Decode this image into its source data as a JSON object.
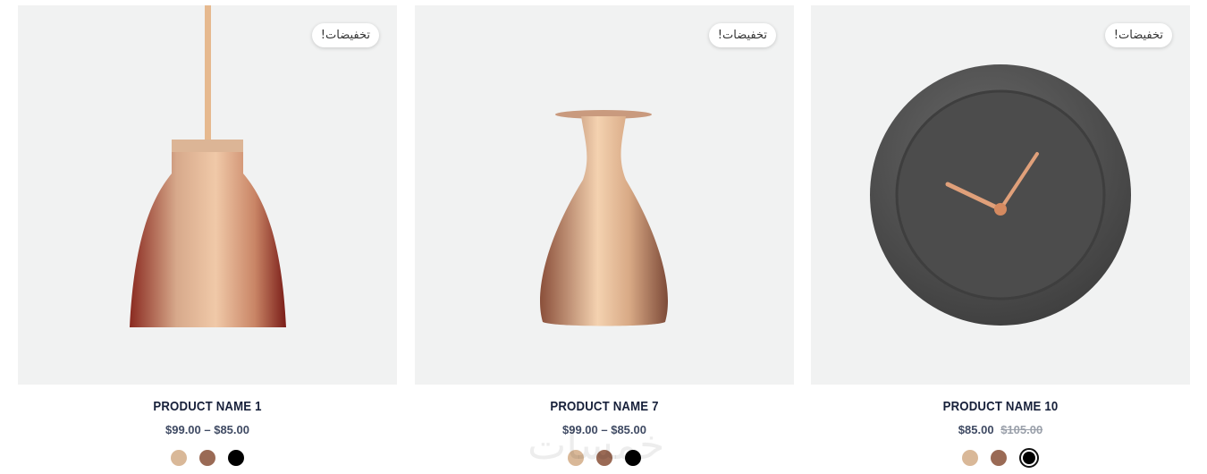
{
  "products": [
    {
      "badge": "تخفيضات!",
      "name": "PRODUCT NAME 1",
      "price": "$99.00 – $85.00",
      "old_price": "",
      "image_icon": "pendant-lamp-icon",
      "swatches": [
        "#d9b898",
        "#9a6a55",
        "#000000"
      ]
    },
    {
      "badge": "تخفيضات!",
      "name": "PRODUCT NAME 7",
      "price": "$99.00 – $85.00",
      "old_price": "",
      "image_icon": "vase-icon",
      "swatches": [
        "#d9b898",
        "#9a6a55",
        "#000000"
      ]
    },
    {
      "badge": "تخفيضات!",
      "name": "PRODUCT NAME 10",
      "price": "$85.00",
      "old_price": "$105.00",
      "image_icon": "wall-clock-icon",
      "swatches": [
        "#d9b898",
        "#9a6a55",
        "#000000"
      ]
    }
  ],
  "watermark": "خمسات"
}
